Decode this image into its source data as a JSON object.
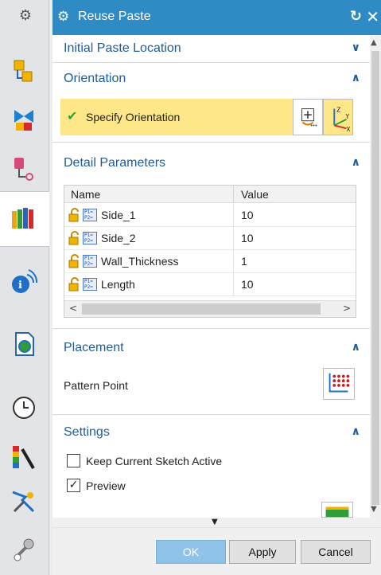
{
  "resource_bar": {
    "icons": [
      "settings-icon",
      "assembly-navigator-icon",
      "constraint-navigator-icon",
      "part-navigator-icon",
      "reuse-library-icon",
      "hd3d-tools-icon",
      "web-browser-icon",
      "history-icon",
      "system-materials-icon",
      "process-studio-icon",
      "roles-icon"
    ]
  },
  "dialog": {
    "title": "Reuse Paste",
    "title_color": "#2e8bc4",
    "sections": {
      "initial_paste_location": {
        "title": "Initial Paste Location",
        "state": "collapsed"
      },
      "orientation": {
        "title": "Orientation",
        "state": "expanded",
        "specify_label": "Specify Orientation"
      },
      "detail_parameters": {
        "title": "Detail Parameters",
        "state": "expanded",
        "columns": [
          "Name",
          "Value"
        ],
        "rows": [
          {
            "name": "Side_1",
            "value": "10"
          },
          {
            "name": "Side_2",
            "value": "10"
          },
          {
            "name": "Wall_Thickness",
            "value": "1"
          },
          {
            "name": "Length",
            "value": "10"
          }
        ]
      },
      "placement": {
        "title": "Placement",
        "state": "expanded",
        "pattern_point_label": "Pattern Point"
      },
      "settings": {
        "title": "Settings",
        "state": "expanded",
        "options": [
          {
            "label": "Keep Current Sketch Active",
            "checked": false
          },
          {
            "label": "Preview",
            "checked": true
          }
        ]
      }
    },
    "buttons": {
      "ok": "OK",
      "apply": "Apply",
      "cancel": "Cancel"
    }
  }
}
